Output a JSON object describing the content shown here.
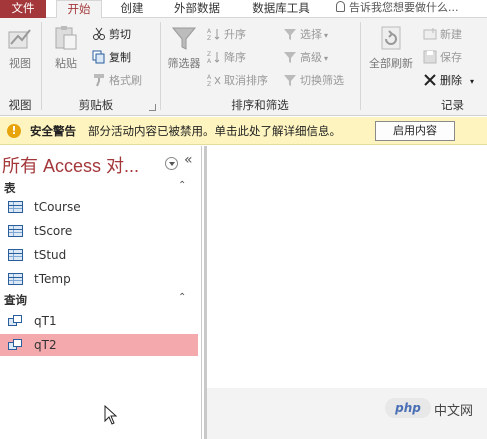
{
  "tabs": {
    "file": "文件",
    "home": "开始",
    "create": "创建",
    "external": "外部数据",
    "dbtools": "数据库工具",
    "tellme": "告诉我您想要做什么..."
  },
  "ribbon": {
    "view": {
      "label": "视图",
      "group": "视图"
    },
    "clipboard": {
      "paste": "粘贴",
      "cut": "剪切",
      "copy": "复制",
      "painter": "格式刷",
      "group": "剪贴板"
    },
    "sortfilter": {
      "filter": "筛选器",
      "asc": "升序",
      "desc": "降序",
      "clear_sort": "取消排序",
      "selection": "选择",
      "advanced": "高级",
      "toggle": "切换筛选",
      "group": "排序和筛选"
    },
    "records": {
      "refresh": "全部刷新",
      "new": "新建",
      "save": "保存",
      "delete": "删除",
      "group": "记录"
    }
  },
  "security": {
    "title": "安全警告",
    "message": "部分活动内容已被禁用。单击此处了解详细信息。",
    "button": "启用内容"
  },
  "nav": {
    "title": "所有 Access 对...",
    "collapse": "«",
    "sections": [
      {
        "label": "表",
        "items": [
          "tCourse",
          "tScore",
          "tStud",
          "tTemp"
        ]
      },
      {
        "label": "查询",
        "items": [
          "qT1",
          "qT2"
        ]
      }
    ]
  },
  "watermark": {
    "logo": "php",
    "text": "中文网"
  },
  "colors": {
    "accent": "#a4373a",
    "selected_item": "#f4a9ad",
    "security_bar": "#fdf4bf"
  }
}
